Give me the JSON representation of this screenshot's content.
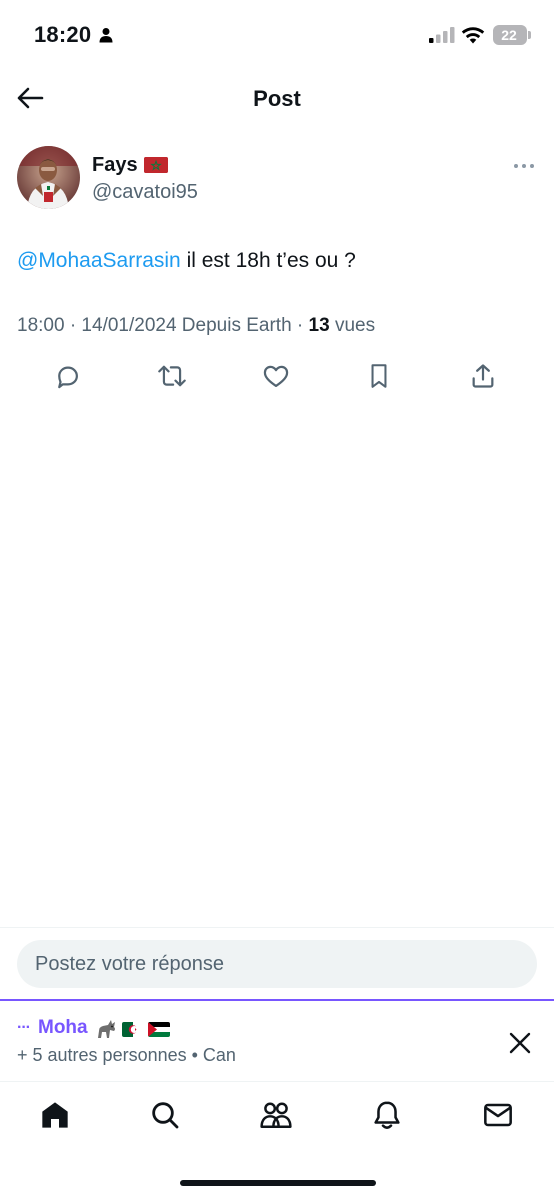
{
  "status_bar": {
    "time": "18:20",
    "battery": "22",
    "battery_level_fraction": 0.22,
    "icons": [
      "person-icon",
      "signal-icon",
      "wifi-icon",
      "battery-icon"
    ]
  },
  "header": {
    "title": "Post",
    "back_icon": "arrow-left-icon"
  },
  "post": {
    "author_name": "Fays",
    "author_flag": "flag-morocco",
    "author_handle": "@cavatoi95",
    "more_icon": "more-dots-icon",
    "mention": "@MohaaSarrasin",
    "text": " il est 18h t’es ou ?",
    "meta_prefix": "18:00 · 14/01/2024 Depuis Earth · ",
    "views_count": "13",
    "views_label": " vues"
  },
  "actions": [
    {
      "icon": "reply-icon"
    },
    {
      "icon": "retweet-icon"
    },
    {
      "icon": "like-icon"
    },
    {
      "icon": "bookmark-icon"
    },
    {
      "icon": "share-icon"
    }
  ],
  "reply_box": {
    "placeholder": "Postez votre réponse"
  },
  "presence_banner": {
    "dots": "···",
    "name": "Moha",
    "emojis": [
      "donkey-icon",
      "flag-algeria",
      "flag-palestine"
    ],
    "subtitle": "+ 5 autres personnes • Can",
    "close_icon": "close-icon"
  },
  "bottom_nav": [
    {
      "icon": "home-icon",
      "active": true
    },
    {
      "icon": "search-icon",
      "active": false
    },
    {
      "icon": "communities-icon",
      "active": false
    },
    {
      "icon": "notifications-icon",
      "active": false
    },
    {
      "icon": "messages-icon",
      "active": false
    }
  ],
  "colors": {
    "accent": "#1d9bf0",
    "text": "#0f1419",
    "secondary_text": "#536471",
    "presence_purple": "#7856ff",
    "reply_box_bg": "#eff3f4"
  }
}
